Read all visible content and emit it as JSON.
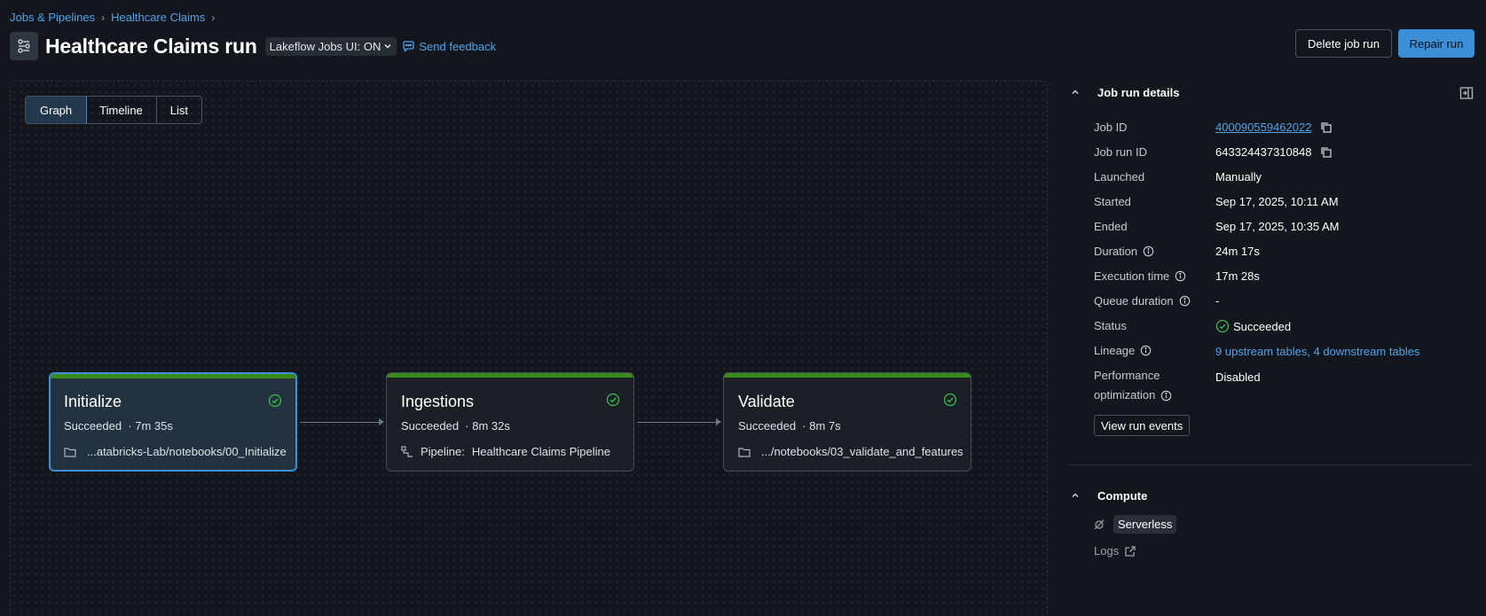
{
  "breadcrumb": {
    "items": [
      "Jobs & Pipelines",
      "Healthcare Claims"
    ]
  },
  "header": {
    "title": "Healthcare Claims run",
    "jobs_ui_toggle": "Lakeflow Jobs UI: ON",
    "feedback": "Send feedback",
    "delete_label": "Delete job run",
    "repair_label": "Repair run"
  },
  "view_tabs": [
    "Graph",
    "Timeline",
    "List"
  ],
  "tasks": [
    {
      "name": "Initialize",
      "status": "Succeeded",
      "duration": "7m 35s",
      "path_icon": "folder-icon",
      "path": "...atabricks-Lab/notebooks/00_Initialize"
    },
    {
      "name": "Ingestions",
      "status": "Succeeded",
      "duration": "8m 32s",
      "path_icon": "pipeline-icon",
      "path_label": "Pipeline:",
      "path": "Healthcare Claims Pipeline"
    },
    {
      "name": "Validate",
      "status": "Succeeded",
      "duration": "8m 7s",
      "path_icon": "folder-icon",
      "path": ".../notebooks/03_validate_and_features"
    }
  ],
  "details": {
    "title": "Job run details",
    "rows": {
      "job_id": {
        "label": "Job ID",
        "value": "400090559462022"
      },
      "job_run_id": {
        "label": "Job run ID",
        "value": "643324437310848"
      },
      "launched": {
        "label": "Launched",
        "value": "Manually"
      },
      "started": {
        "label": "Started",
        "value": "Sep 17, 2025, 10:11 AM"
      },
      "ended": {
        "label": "Ended",
        "value": "Sep 17, 2025, 10:35 AM"
      },
      "duration": {
        "label": "Duration",
        "value": "24m 17s"
      },
      "execution_time": {
        "label": "Execution time",
        "value": "17m 28s"
      },
      "queue_duration": {
        "label": "Queue duration",
        "value": "-"
      },
      "status": {
        "label": "Status",
        "value": "Succeeded"
      },
      "lineage": {
        "label": "Lineage",
        "value": "9 upstream tables, 4 downstream tables"
      },
      "performance": {
        "label_line1": "Performance",
        "label_line2": "optimization",
        "value": "Disabled"
      }
    },
    "view_events": "View run events"
  },
  "compute": {
    "title": "Compute",
    "serverless": "Serverless",
    "logs": "Logs"
  },
  "colors": {
    "accent": "#3b8fd6",
    "success": "#3fb950",
    "success_bar": "#3a8a1e",
    "link": "#4fa3ea"
  }
}
